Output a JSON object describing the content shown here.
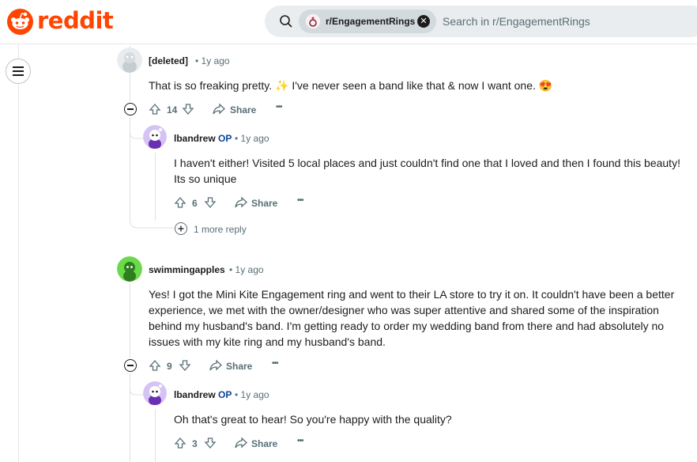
{
  "header": {
    "logo_text": "reddit",
    "search": {
      "community_chip": "r/EngagementRings",
      "placeholder": "Search in r/EngagementRings"
    }
  },
  "comments": [
    {
      "author": "[deleted]",
      "time": "1y ago",
      "body": "That is so freaking pretty. ✨ I've never seen a band like that & now I want one. 😍",
      "votes": "14",
      "share": "Share",
      "more": "•••",
      "replies": [
        {
          "author": "lbandrew",
          "op": "OP",
          "time": "1y ago",
          "body": "I haven't either! Visited 5 local places and just couldn't find one that I loved and then I found this beauty! Its so unique",
          "votes": "6",
          "share": "Share",
          "more": "•••"
        }
      ],
      "more_replies": "1 more reply"
    },
    {
      "author": "swimmingapples",
      "time": "1y ago",
      "body": "Yes! I got the Mini Kite Engagement ring and went to their LA store to try it on. It couldn't have been a better experience, we met with the owner/designer who was super attentive and shared some of the inspiration behind my husband's band. I'm getting ready to order my wedding band from there and had absolutely no issues with my kite ring and my husband's band.",
      "votes": "9",
      "share": "Share",
      "more": "•••",
      "replies": [
        {
          "author": "lbandrew",
          "op": "OP",
          "time": "1y ago",
          "body": "Oh that's great to hear! So you're happy with the quality?",
          "votes": "3",
          "share": "Share",
          "more": "•••"
        }
      ]
    }
  ],
  "colors": {
    "brand": "#ff4500",
    "op_blue": "#0a449b",
    "meta_gray": "#576f76"
  }
}
